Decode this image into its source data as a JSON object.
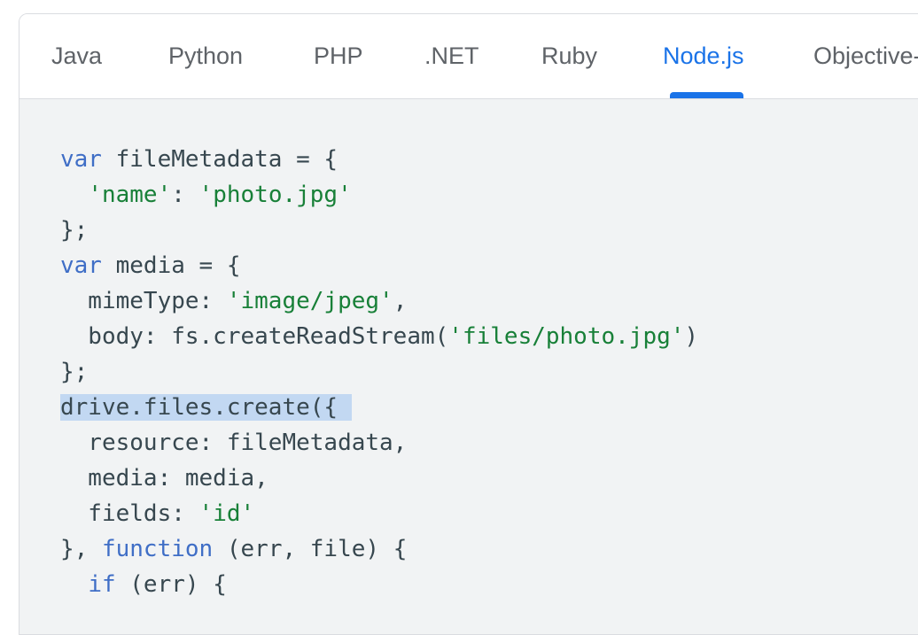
{
  "tabs": {
    "items": [
      {
        "label": "Java"
      },
      {
        "label": "Python"
      },
      {
        "label": "PHP"
      },
      {
        "label": ".NET"
      },
      {
        "label": "Ruby"
      },
      {
        "label": "Node.js"
      },
      {
        "label": "Objective-C"
      }
    ],
    "active_index": 5
  },
  "code": {
    "language": "Node.js",
    "highlighted_text": "drive.files.create({ ",
    "lines": [
      [
        [
          "var",
          "kw"
        ],
        [
          " fileMetadata = {",
          ""
        ]
      ],
      [
        [
          "  ",
          ""
        ],
        [
          "'name'",
          "str"
        ],
        [
          ": ",
          ""
        ],
        [
          "'photo.jpg'",
          "str"
        ]
      ],
      [
        [
          "};",
          ""
        ]
      ],
      [
        [
          "var",
          "kw"
        ],
        [
          " media = {",
          ""
        ]
      ],
      [
        [
          "  mimeType: ",
          ""
        ],
        [
          "'image/jpeg'",
          "str"
        ],
        [
          ",",
          ""
        ]
      ],
      [
        [
          "  body: fs.createReadStream(",
          ""
        ],
        [
          "'files/photo.jpg'",
          "str"
        ],
        [
          ")",
          ""
        ]
      ],
      [
        [
          "};",
          ""
        ]
      ],
      [
        [
          "drive.files.create({ ",
          "sel"
        ]
      ],
      [
        [
          "  resource: fileMetadata,",
          ""
        ]
      ],
      [
        [
          "  media: media,",
          ""
        ]
      ],
      [
        [
          "  fields: ",
          ""
        ],
        [
          "'id'",
          "str"
        ]
      ],
      [
        [
          "}, ",
          ""
        ],
        [
          "function",
          "kw"
        ],
        [
          " (err, file) {",
          ""
        ]
      ],
      [
        [
          "  ",
          ""
        ],
        [
          "if",
          "kw"
        ],
        [
          " (err) {",
          ""
        ]
      ]
    ]
  },
  "colors": {
    "accent": "#1a73e8",
    "keyword": "#3f6ec6",
    "string": "#188038",
    "code_text": "#37474f",
    "code_background": "#f1f3f4",
    "selection": "#c2d8f2"
  }
}
